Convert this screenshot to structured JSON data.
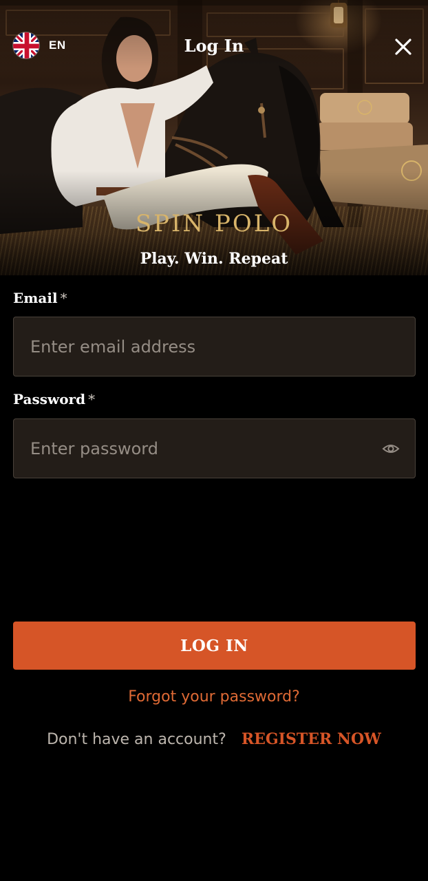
{
  "header": {
    "language": "EN",
    "title": "Log In"
  },
  "hero": {
    "brand": "SPIN POLO",
    "tagline": "Play. Win. Repeat"
  },
  "form": {
    "email": {
      "label": "Email",
      "required_mark": "*",
      "placeholder": "Enter email address",
      "value": ""
    },
    "password": {
      "label": "Password",
      "required_mark": "*",
      "placeholder": "Enter password",
      "value": ""
    },
    "submit_label": "LOG IN",
    "forgot_label": "Forgot your password?",
    "no_account_text": "Don't have an account?",
    "register_label": "REGISTER NOW"
  },
  "colors": {
    "accent": "#d65527",
    "link": "#df6a35",
    "brand_gold": "#d8b46a",
    "field_bg": "#231d18",
    "field_border": "#4a423a",
    "page_bg": "#000000"
  },
  "icons": {
    "language": "uk-flag-icon",
    "close": "close-icon",
    "password_toggle": "eye-icon"
  }
}
